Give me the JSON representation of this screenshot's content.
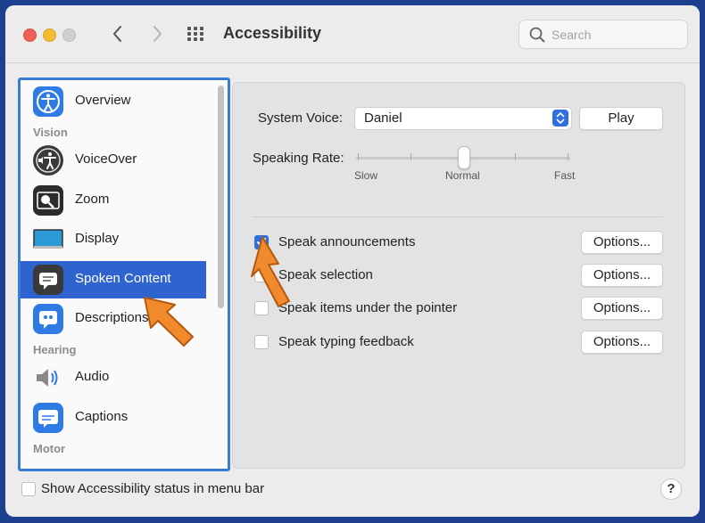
{
  "window": {
    "title": "Accessibility"
  },
  "search": {
    "placeholder": "Search"
  },
  "sidebar": {
    "items": [
      {
        "label": "Overview",
        "icon": "accessibility-icon"
      },
      {
        "label": "VoiceOver",
        "icon": "voiceover-icon"
      },
      {
        "label": "Zoom",
        "icon": "zoom-icon"
      },
      {
        "label": "Display",
        "icon": "display-icon"
      },
      {
        "label": "Spoken Content",
        "icon": "spoken-content-icon",
        "selected": true
      },
      {
        "label": "Descriptions",
        "icon": "descriptions-icon"
      },
      {
        "label": "Audio",
        "icon": "speaker-icon"
      },
      {
        "label": "Captions",
        "icon": "captions-icon"
      }
    ],
    "sections": {
      "vision": "Vision",
      "hearing": "Hearing",
      "motor": "Motor"
    }
  },
  "speech": {
    "system_voice_label": "System Voice:",
    "system_voice_value": "Daniel",
    "play_label": "Play",
    "speaking_rate_label": "Speaking Rate:",
    "rate_slow": "Slow",
    "rate_normal": "Normal",
    "rate_fast": "Fast",
    "rate_position": 0.5
  },
  "options": [
    {
      "label": "Speak announcements",
      "checked": true,
      "button": "Options..."
    },
    {
      "label": "Speak selection",
      "checked": false,
      "button": "Options..."
    },
    {
      "label": "Speak items under the pointer",
      "checked": false,
      "button": "Options..."
    },
    {
      "label": "Speak typing feedback",
      "checked": false,
      "button": "Options..."
    }
  ],
  "footer": {
    "status_label": "Show Accessibility status in menu bar",
    "status_checked": false,
    "help_label": "?"
  },
  "colors": {
    "accent": "#2f63d0",
    "highlight_border": "#3a7bd5",
    "arrow": "#f08a2c"
  }
}
